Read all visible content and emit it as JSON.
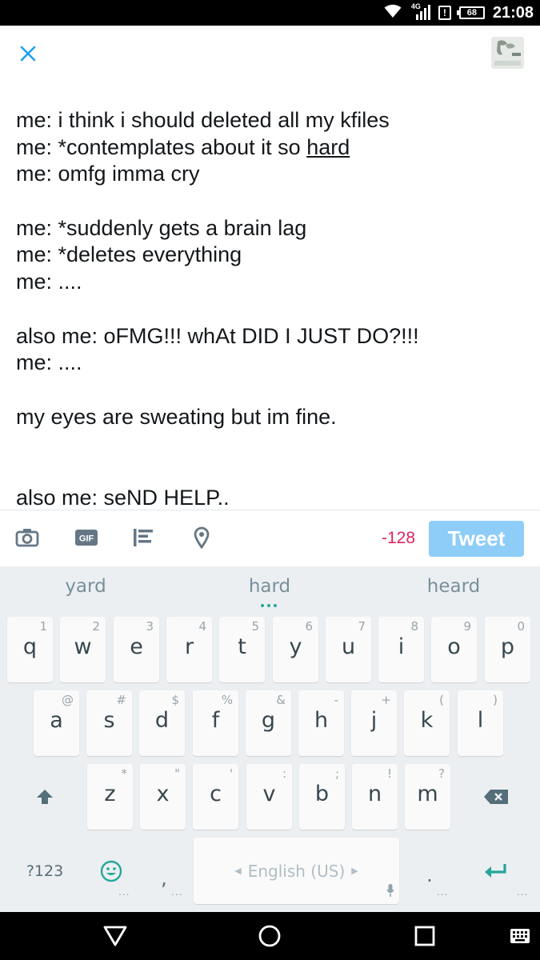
{
  "status_bar": {
    "network": "4G",
    "battery": "68",
    "time": "21:08",
    "icons": [
      "wifi-icon",
      "signal-icon",
      "alert-icon",
      "battery-icon"
    ]
  },
  "compose": {
    "close_icon": "close-icon",
    "tweet_lines": [
      {
        "text": "me: i think i should deleted all my kfiles"
      },
      {
        "text": "me: *contemplates about it so ",
        "underlined": "hard"
      },
      {
        "text": "me: omfg imma cry"
      },
      {
        "text": ""
      },
      {
        "text": "me: *suddenly gets a brain lag"
      },
      {
        "text": "me: *deletes everything"
      },
      {
        "text": "me: ...."
      },
      {
        "text": ""
      },
      {
        "text": "also me: oFMG!!! whAt DID I JUST DO?!!!"
      },
      {
        "text": "me: ...."
      },
      {
        "text": ""
      },
      {
        "text": "my eyes are sweating but im fine."
      },
      {
        "text": ""
      },
      {
        "text": ""
      },
      {
        "text": "also me: seND HELP.."
      }
    ]
  },
  "toolbar": {
    "char_count": "-128",
    "tweet_label": "Tweet",
    "accent_color": "#1da1f2",
    "disabled_button_color": "#8ecdf8",
    "count_color": "#e0245e"
  },
  "keyboard": {
    "suggestions": [
      "yard",
      "hard",
      "heard"
    ],
    "row1": [
      {
        "key": "q",
        "hint": "1"
      },
      {
        "key": "w",
        "hint": "2"
      },
      {
        "key": "e",
        "hint": "3"
      },
      {
        "key": "r",
        "hint": "4"
      },
      {
        "key": "t",
        "hint": "5"
      },
      {
        "key": "y",
        "hint": "6"
      },
      {
        "key": "u",
        "hint": "7"
      },
      {
        "key": "i",
        "hint": "8"
      },
      {
        "key": "o",
        "hint": "9"
      },
      {
        "key": "p",
        "hint": "0"
      }
    ],
    "row2": [
      {
        "key": "a",
        "hint": "@"
      },
      {
        "key": "s",
        "hint": "#"
      },
      {
        "key": "d",
        "hint": "$"
      },
      {
        "key": "f",
        "hint": "%"
      },
      {
        "key": "g",
        "hint": "&"
      },
      {
        "key": "h",
        "hint": "-"
      },
      {
        "key": "j",
        "hint": "+"
      },
      {
        "key": "k",
        "hint": "("
      },
      {
        "key": "l",
        "hint": ")"
      }
    ],
    "row3": [
      {
        "key": "z",
        "hint": "*"
      },
      {
        "key": "x",
        "hint": "\""
      },
      {
        "key": "c",
        "hint": "'"
      },
      {
        "key": "v",
        "hint": ":"
      },
      {
        "key": "b",
        "hint": ";"
      },
      {
        "key": "n",
        "hint": "!"
      },
      {
        "key": "m",
        "hint": "?"
      }
    ],
    "symbols_label": "?123",
    "comma": ",",
    "period": ".",
    "space_label": "English (US)",
    "accent_color": "#26a69a"
  }
}
